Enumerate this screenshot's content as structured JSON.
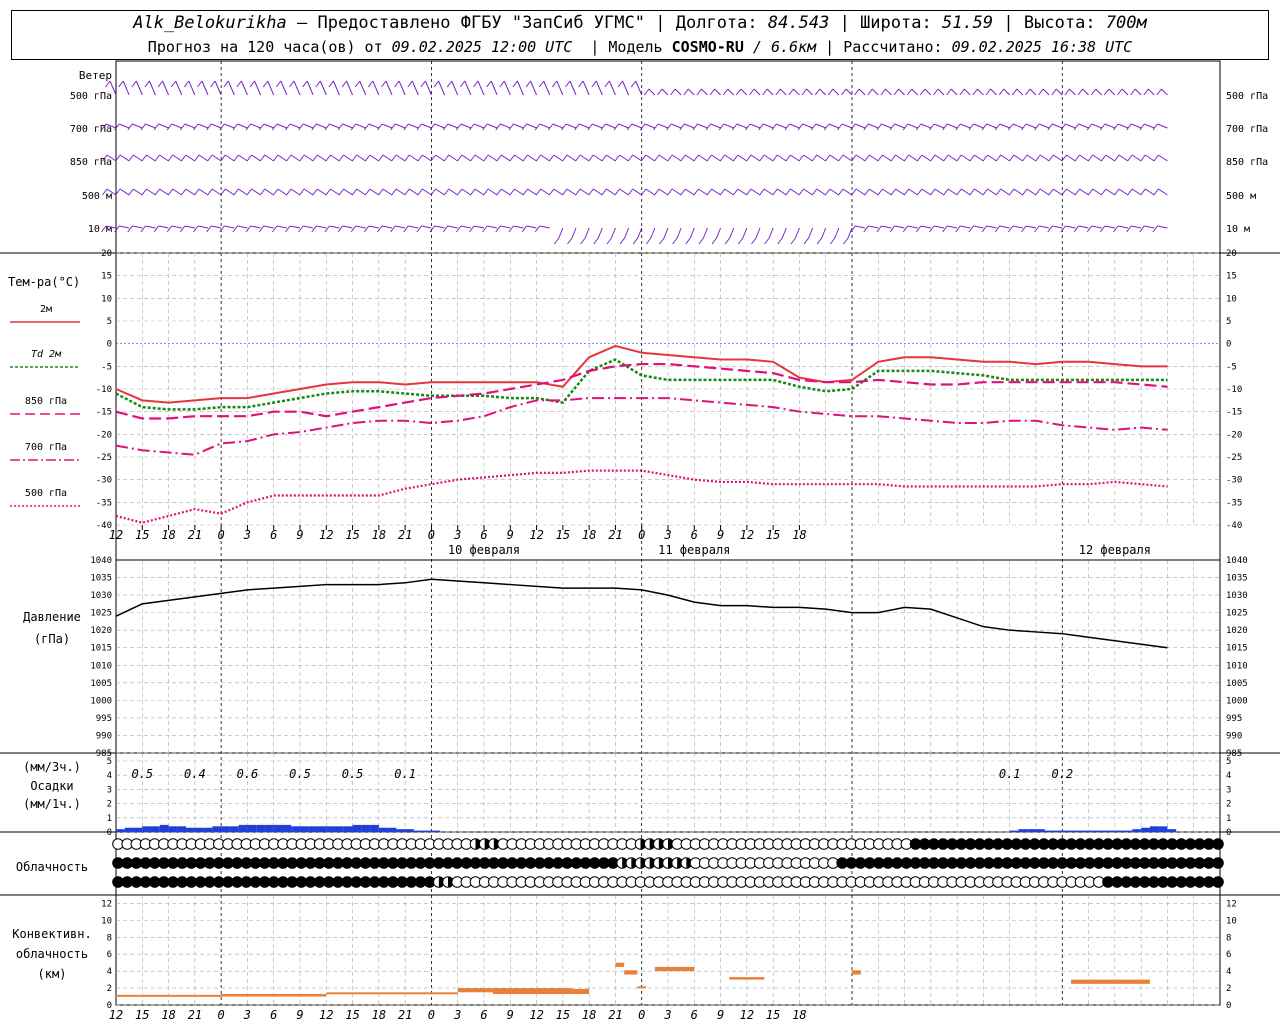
{
  "header": {
    "station": "Alk_Belokurikha",
    "provider": "– Предоставлено ФГБУ \"ЗапСиб УГМС\"",
    "sep": "|",
    "lon_label": "Долгота:",
    "lon_value": "84.543",
    "lat_label": "Широта:",
    "lat_value": "51.59",
    "alt_label": "Высота:",
    "alt_value": "700м"
  },
  "subheader": {
    "forecast": "Прогноз на 120 часа(ов) от",
    "issued": "09.02.2025 12:00 UTC",
    "model_label": "Модель",
    "model": "COSMO-RU",
    "resolution": "/ 6.6км",
    "calc_label": "Рассчитано:",
    "calc": "09.02.2025 16:38 UTC"
  },
  "labels": {
    "wind": "Ветер",
    "wind_levels": [
      "500 гПа",
      "700 гПа",
      "850 гПа",
      "500 м",
      "10  м"
    ],
    "temp": "Тем-ра(°C)",
    "t2m": "2м",
    "td": "Td",
    "td2m": "2м",
    "t850": "850 гПа",
    "t700": "700 гПа",
    "t500": "500 гПа",
    "pressure": "Давление",
    "pressure_unit": "(гПа)",
    "precip_3h": "(мм/3ч.)",
    "precip": "Осадки",
    "precip_1h": "(мм/1ч.)",
    "cloud": "Облачность",
    "conv1": "Конвективн.",
    "conv2": "облачность",
    "conv3": "(км)"
  },
  "colors": {
    "t2m": "#e8343c",
    "td": "#138a13",
    "t850": "#e0107a",
    "t700": "#e0107a",
    "t500": "#e0107a",
    "wind": "#7a22c8",
    "pressure": "#000000",
    "precip": "#1f3fd8",
    "conv": "#e8803a",
    "zero_line": "#3050e0"
  },
  "time_axis": {
    "hours": [
      "12",
      "15",
      "18",
      "21",
      "0",
      "3",
      "6",
      "9",
      "12",
      "15",
      "18",
      "21",
      "0",
      "3",
      "6",
      "9",
      "12",
      "15",
      "18",
      "21",
      "0",
      "3",
      "6",
      "9",
      "12",
      "15",
      "18"
    ],
    "day_labels": [
      "10 февраля",
      "11 февраля",
      "12 февраля"
    ]
  },
  "chart_data": {
    "type": "line",
    "x_unit": "hours since 09.02.2025 12:00 UTC",
    "temperature": {
      "ylim": [
        -40,
        20
      ],
      "ticks": [
        20,
        15,
        10,
        5,
        0,
        -5,
        -10,
        -15,
        -20,
        -25,
        -30,
        -35,
        -40
      ],
      "series": [
        {
          "name": "2м",
          "x": [
            0,
            3,
            6,
            9,
            12,
            15,
            18,
            21,
            24,
            27,
            30,
            33,
            36,
            39,
            42,
            45,
            48,
            51,
            54,
            57,
            60,
            63,
            66,
            69,
            72,
            75,
            78,
            81,
            84,
            87,
            90,
            93,
            96,
            99,
            102,
            105,
            108,
            111,
            114,
            117,
            120
          ],
          "values": [
            -10,
            -12.5,
            -13,
            -12.5,
            -12,
            -12,
            -11,
            -10,
            -9,
            -8.5,
            -8.5,
            -9,
            -8.5,
            -8.5,
            -8.5,
            -8.5,
            -8.5,
            -9.5,
            -3,
            -0.5,
            -2,
            -2.5,
            -3,
            -3.5,
            -3.5,
            -4,
            -7.5,
            -8.5,
            -8,
            -4,
            -3,
            -3,
            -3.5,
            -4,
            -4,
            -4.5,
            -4,
            -4,
            -4.5,
            -5,
            -5
          ]
        },
        {
          "name": "Td 2м",
          "x": [
            0,
            3,
            6,
            9,
            12,
            15,
            18,
            21,
            24,
            27,
            30,
            33,
            36,
            39,
            42,
            45,
            48,
            51,
            54,
            57,
            60,
            63,
            66,
            69,
            72,
            75,
            78,
            81,
            84,
            87,
            90,
            93,
            96,
            99,
            102,
            105,
            108,
            111,
            114,
            117,
            120
          ],
          "values": [
            -11,
            -14,
            -14.5,
            -14.5,
            -14,
            -14,
            -13,
            -12,
            -11,
            -10.5,
            -10.5,
            -11,
            -11.5,
            -11.5,
            -11.5,
            -12,
            -12,
            -13,
            -6,
            -3.5,
            -7,
            -8,
            -8,
            -8,
            -8,
            -8,
            -9.5,
            -10.5,
            -10,
            -6,
            -6,
            -6,
            -6.5,
            -7,
            -8,
            -8,
            -8,
            -8,
            -8,
            -8,
            -8
          ]
        },
        {
          "name": "850 гПа",
          "x": [
            0,
            3,
            6,
            9,
            12,
            15,
            18,
            21,
            24,
            27,
            30,
            33,
            36,
            39,
            42,
            45,
            48,
            51,
            54,
            57,
            60,
            63,
            66,
            69,
            72,
            75,
            78,
            81,
            84,
            87,
            90,
            93,
            96,
            99,
            102,
            105,
            108,
            111,
            114,
            117,
            120
          ],
          "values": [
            -15,
            -16.5,
            -16.5,
            -16,
            -16,
            -16,
            -15,
            -15,
            -16,
            -15,
            -14,
            -13,
            -12,
            -11.5,
            -11,
            -10,
            -9,
            -8,
            -6,
            -5,
            -4.5,
            -4.5,
            -5,
            -5.5,
            -6,
            -6.5,
            -8,
            -8.5,
            -8.5,
            -8,
            -8.5,
            -9,
            -9,
            -8.5,
            -8.5,
            -8.5,
            -8.5,
            -8.5,
            -8.5,
            -9,
            -9.5
          ]
        },
        {
          "name": "700 гПа",
          "x": [
            0,
            3,
            6,
            9,
            12,
            15,
            18,
            21,
            24,
            27,
            30,
            33,
            36,
            39,
            42,
            45,
            48,
            51,
            54,
            57,
            60,
            63,
            66,
            69,
            72,
            75,
            78,
            81,
            84,
            87,
            90,
            93,
            96,
            99,
            102,
            105,
            108,
            111,
            114,
            117,
            120
          ],
          "values": [
            -22.5,
            -23.5,
            -24,
            -24.5,
            -22,
            -21.5,
            -20,
            -19.5,
            -18.5,
            -17.5,
            -17,
            -17,
            -17.5,
            -17,
            -16,
            -14,
            -12.5,
            -12.5,
            -12,
            -12,
            -12,
            -12,
            -12.5,
            -13,
            -13.5,
            -14,
            -15,
            -15.5,
            -16,
            -16,
            -16.5,
            -17,
            -17.5,
            -17.5,
            -17,
            -17,
            -18,
            -18.5,
            -19,
            -18.5,
            -19
          ]
        },
        {
          "name": "500 гПа",
          "x": [
            0,
            3,
            6,
            9,
            12,
            15,
            18,
            21,
            24,
            27,
            30,
            33,
            36,
            39,
            42,
            45,
            48,
            51,
            54,
            57,
            60,
            63,
            66,
            69,
            72,
            75,
            78,
            81,
            84,
            87,
            90,
            93,
            96,
            99,
            102,
            105,
            108,
            111,
            114,
            117,
            120
          ],
          "values": [
            -38,
            -39.5,
            -38,
            -36.5,
            -37.5,
            -35,
            -33.5,
            -33.5,
            -33.5,
            -33.5,
            -33.5,
            -32,
            -31,
            -30,
            -29.5,
            -29,
            -28.5,
            -28.5,
            -28,
            -28,
            -28,
            -29,
            -30,
            -30.5,
            -30.5,
            -31,
            -31,
            -31,
            -31,
            -31,
            -31.5,
            -31.5,
            -31.5,
            -31.5,
            -31.5,
            -31.5,
            -31,
            -31,
            -30.5,
            -31,
            -31.5
          ]
        }
      ]
    },
    "pressure": {
      "ylim": [
        985,
        1040
      ],
      "ticks": [
        1040,
        1035,
        1030,
        1025,
        1020,
        1015,
        1010,
        1005,
        1000,
        995,
        990,
        985
      ],
      "x": [
        0,
        3,
        6,
        9,
        12,
        15,
        18,
        21,
        24,
        27,
        30,
        33,
        36,
        39,
        42,
        45,
        48,
        51,
        54,
        57,
        60,
        63,
        66,
        69,
        72,
        75,
        78,
        81,
        84,
        87,
        90,
        93,
        96,
        99,
        102,
        105,
        108,
        111,
        114,
        117,
        120
      ],
      "values": [
        1024,
        1027.5,
        1028.5,
        1029.5,
        1030.5,
        1031.5,
        1032,
        1032.5,
        1033,
        1033,
        1033,
        1033.5,
        1034.5,
        1034,
        1033.5,
        1033,
        1032.5,
        1032,
        1032,
        1032,
        1031.5,
        1030,
        1028,
        1027,
        1027,
        1026.5,
        1026.5,
        1026,
        1025,
        1025,
        1026.5,
        1026,
        1023.5,
        1021,
        1020,
        1019.5,
        1019,
        1018,
        1017,
        1016,
        1015
      ]
    },
    "precipitation": {
      "ylim": [
        0,
        5
      ],
      "ticks": [
        5,
        4,
        3,
        2,
        1,
        0
      ],
      "labels_3h": [
        {
          "x": 3,
          "text": "0.5"
        },
        {
          "x": 9,
          "text": "0.4"
        },
        {
          "x": 15,
          "text": "0.6"
        },
        {
          "x": 21,
          "text": "0.5"
        },
        {
          "x": 27,
          "text": "0.5"
        },
        {
          "x": 33,
          "text": "0.1"
        },
        {
          "x": 102,
          "text": "0.1"
        },
        {
          "x": 108,
          "text": "0.2"
        }
      ],
      "x": [
        0,
        1,
        2,
        3,
        4,
        5,
        6,
        7,
        8,
        9,
        10,
        11,
        12,
        13,
        14,
        15,
        16,
        17,
        18,
        19,
        20,
        21,
        22,
        23,
        24,
        25,
        26,
        27,
        28,
        29,
        30,
        31,
        32,
        33,
        34,
        35,
        36,
        102,
        103,
        104,
        105,
        106,
        107,
        108,
        109,
        110,
        111,
        112,
        113,
        114,
        115,
        116,
        117,
        118,
        119,
        120
      ],
      "values": [
        0.2,
        0.3,
        0.3,
        0.4,
        0.4,
        0.5,
        0.4,
        0.4,
        0.3,
        0.3,
        0.3,
        0.4,
        0.4,
        0.4,
        0.5,
        0.5,
        0.5,
        0.5,
        0.5,
        0.5,
        0.4,
        0.4,
        0.4,
        0.4,
        0.4,
        0.4,
        0.4,
        0.5,
        0.5,
        0.5,
        0.3,
        0.3,
        0.2,
        0.2,
        0.1,
        0.1,
        0.1,
        0.1,
        0.2,
        0.2,
        0.2,
        0.1,
        0.1,
        0.1,
        0.1,
        0.1,
        0.1,
        0.1,
        0.1,
        0.1,
        0.1,
        0.2,
        0.3,
        0.4,
        0.4,
        0.2
      ]
    },
    "convective_cloud": {
      "ylim": [
        0,
        13
      ],
      "ticks": [
        12,
        10,
        8,
        6,
        4,
        2,
        0
      ],
      "segments": [
        {
          "x0": 0,
          "x1": 12,
          "bottom": 1.0,
          "top": 1.2
        },
        {
          "x0": 12,
          "x1": 24,
          "bottom": 1.0,
          "top": 1.3
        },
        {
          "x0": 24,
          "x1": 39,
          "bottom": 1.3,
          "top": 1.5
        },
        {
          "x0": 39,
          "x1": 43,
          "bottom": 1.5,
          "top": 2.0
        },
        {
          "x0": 43,
          "x1": 52,
          "bottom": 1.3,
          "top": 2.0
        },
        {
          "x0": 52,
          "x1": 54,
          "bottom": 1.3,
          "top": 1.9
        },
        {
          "x0": 57,
          "x1": 58,
          "bottom": 4.5,
          "top": 5.0
        },
        {
          "x0": 58,
          "x1": 59.5,
          "bottom": 3.6,
          "top": 4.1
        },
        {
          "x0": 59.5,
          "x1": 60.5,
          "bottom": 2.0,
          "top": 2.2
        },
        {
          "x0": 61.5,
          "x1": 66,
          "bottom": 4.0,
          "top": 4.5
        },
        {
          "x0": 70,
          "x1": 74,
          "bottom": 3.0,
          "top": 3.3
        },
        {
          "x0": 126,
          "x1": 127,
          "bottom": 3.6,
          "top": 4.1
        },
        {
          "x0": 109,
          "x1": 118,
          "bottom": 2.5,
          "top": 3.0
        }
      ]
    }
  }
}
